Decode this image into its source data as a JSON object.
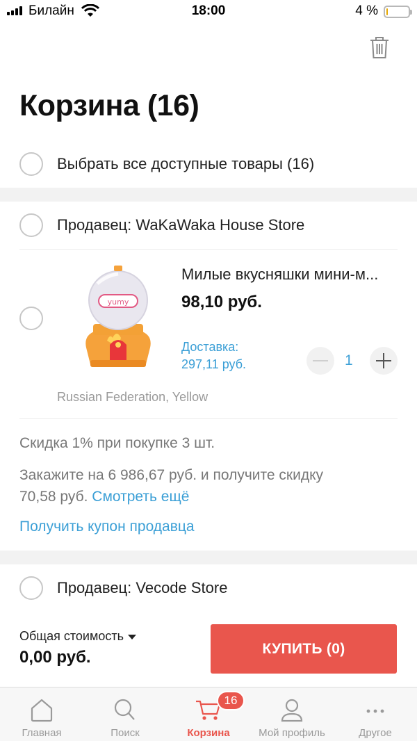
{
  "status_bar": {
    "carrier": "Билайн",
    "time": "18:00",
    "battery": "4 %",
    "battery_level": 0.04
  },
  "header": {
    "title": "Корзина (16)",
    "delete_icon": "trash-icon"
  },
  "select_all": {
    "label": "Выбрать все доступные товары (16)"
  },
  "sellers": [
    {
      "label": "Продавец: WaKaWaka House Store",
      "items": [
        {
          "title": "Милые вкусняшки мини-м...",
          "price": "98,10 руб.",
          "delivery_label": "Доставка:",
          "delivery_price": "297,11 руб.",
          "quantity": "1",
          "variant": "Russian Federation, Yellow",
          "image_icon": "gumball-machine-image"
        }
      ],
      "promo": {
        "discount": "Скидка 1% при покупке 3 шт.",
        "order_more_line1": "Закажите на 6 986,67 руб. и получите скидку",
        "order_more_line2": "70,58 руб.",
        "see_more": "Смотреть ещё",
        "coupon": "Получить купон продавца"
      }
    },
    {
      "label": "Продавец: Vecode Store"
    }
  ],
  "footer": {
    "total_label": "Общая стоимость",
    "total": "0,00 руб.",
    "buy_button": "КУПИТЬ (0)"
  },
  "tab_bar": {
    "badge": "16",
    "tabs": [
      {
        "label": "Главная",
        "icon": "home-icon"
      },
      {
        "label": "Поиск",
        "icon": "search-icon"
      },
      {
        "label": "Корзина",
        "icon": "cart-icon",
        "active": true
      },
      {
        "label": "Мой профиль",
        "icon": "profile-icon"
      },
      {
        "label": "Другое",
        "icon": "more-icon"
      }
    ]
  },
  "colors": {
    "accent": "#e9564d",
    "link": "#3b9fd6",
    "muted": "#9a9a9a"
  }
}
